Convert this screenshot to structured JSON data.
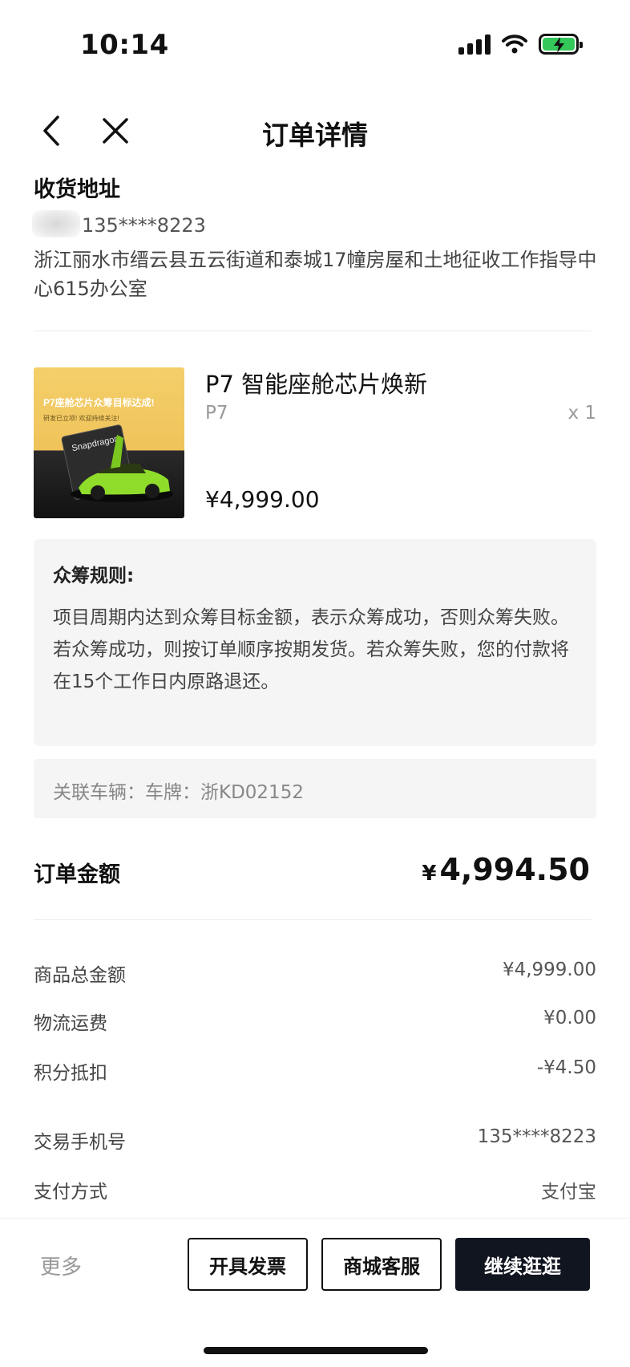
{
  "status_bar": {
    "time": "10:14",
    "icons": [
      "signal-icon",
      "wifi-icon",
      "battery-charging-icon"
    ],
    "battery_color": "#34c759"
  },
  "nav": {
    "title": "订单详情",
    "back_icon": "chevron-left-icon",
    "close_icon": "close-icon"
  },
  "address": {
    "heading": "收货地址",
    "phone": "135****8223",
    "detail": "浙江丽水市缙云县五云街道和泰城17幢房屋和土地征收工作指导中心615办公室"
  },
  "product": {
    "name": "P7 智能座舱芯片焕新",
    "variant": "P7",
    "quantity": "x 1",
    "price": "¥4,999.00",
    "image_banner": "P7座舱芯片众筹目标达成!",
    "image_sub": "研发已立项! 欢迎持续关注!",
    "image_brand": "Snapdragon"
  },
  "rules": {
    "title": "众筹规则:",
    "line1": "项目周期内达到众筹目标金额，表示众筹成功，否则众筹失败。",
    "line2": "若众筹成功，则按订单顺序按期发货。若众筹失败，您的付款将在15个工作日内原路退还。"
  },
  "vehicle": {
    "text": "关联车辆：车牌：浙KD02152"
  },
  "order_total": {
    "label": "订单金额",
    "currency": "¥",
    "amount": "4,994.50"
  },
  "details": [
    {
      "label": "商品总金额",
      "value": "¥4,999.00"
    },
    {
      "label": "物流运费",
      "value": "¥0.00"
    },
    {
      "label": "积分抵扣",
      "value": "-¥4.50"
    },
    {
      "label": "交易手机号",
      "value": "135****8223"
    },
    {
      "label": "支付方式",
      "value": "支付宝"
    }
  ],
  "bottom_bar": {
    "more": "更多",
    "invoice_button": "开具发票",
    "service_button": "商城客服",
    "continue_button": "继续逛逛",
    "dark_button_color": "#111520"
  }
}
